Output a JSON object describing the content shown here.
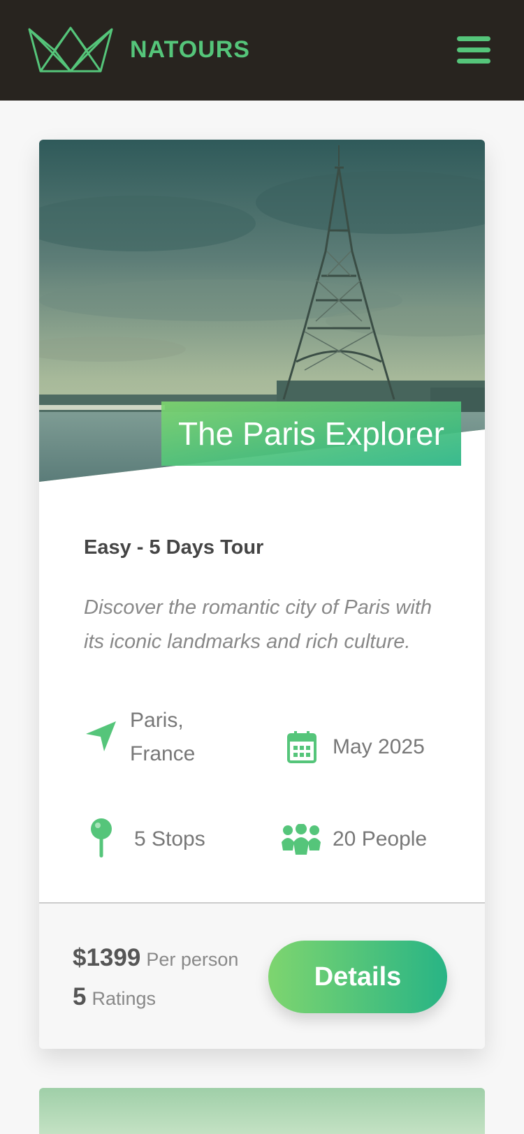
{
  "header": {
    "brand": "NATOURS",
    "logo_icon": "crown-logo-icon",
    "menu_icon": "hamburger-menu-icon",
    "accent_color": "#55c57a",
    "background_color": "#28241f"
  },
  "card": {
    "title": "The Paris Explorer",
    "subtitle": "Easy - 5 Days Tour",
    "summary": "Discover the romantic city of Paris with its iconic landmarks and rich culture.",
    "details": {
      "location_line1": "Paris,",
      "location_line2": "France",
      "date": "May 2025",
      "stops": "5 Stops",
      "people": "20 People"
    },
    "footer": {
      "price": "$1399",
      "price_label": "Per person",
      "ratings_value": "5",
      "ratings_label": "Ratings",
      "button_label": "Details"
    },
    "gradient_colors": [
      "#7ed56f",
      "#28b485"
    ]
  }
}
